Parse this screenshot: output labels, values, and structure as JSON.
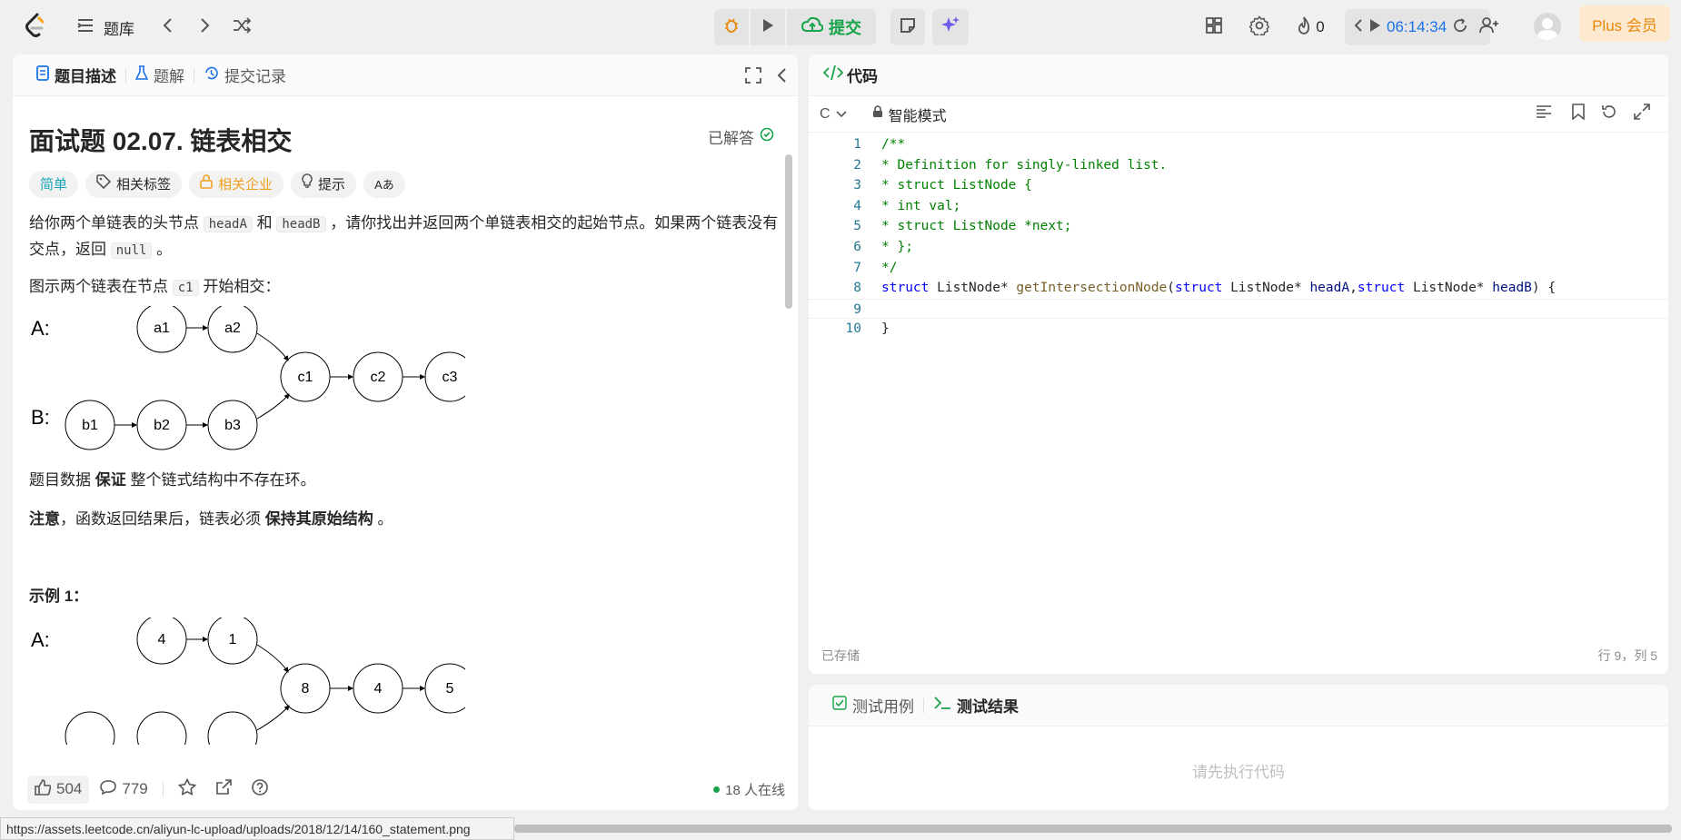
{
  "topbar": {
    "problem_bank": "题库",
    "submit": "提交",
    "streak": "0",
    "timer": "06:14:34",
    "plus": "Plus 会员"
  },
  "left": {
    "tabs": [
      "题目描述",
      "题解",
      "提交记录"
    ],
    "title": "面试题 02.07. 链表相交",
    "solved": "已解答",
    "chips": {
      "difficulty": "简单",
      "tags": "相关标签",
      "companies": "相关企业",
      "hint": "提示",
      "font": "Aあ"
    },
    "desc1_a": "给你两个单链表的头节点 ",
    "desc1_code1": "headA",
    "desc1_b": " 和 ",
    "desc1_code2": "headB",
    "desc1_c": " ，请你找出并返回两个单链表相交的起始节点。如果两个链表没有交点，返回 ",
    "desc1_code3": "null",
    "desc1_d": " 。",
    "desc2_a": "图示两个链表在节点 ",
    "desc2_code": "c1",
    "desc2_b": " 开始相交：",
    "diagram1": {
      "A": "A:",
      "B": "B:",
      "a": [
        "a1",
        "a2"
      ],
      "c": [
        "c1",
        "c2",
        "c3"
      ],
      "b": [
        "b1",
        "b2",
        "b3"
      ]
    },
    "desc3_a": "题目数据 ",
    "desc3_strong": "保证",
    "desc3_b": " 整个链式结构中不存在环。",
    "desc4_strong1": "注意",
    "desc4_a": "，函数返回结果后，链表必须 ",
    "desc4_strong2": "保持其原始结构",
    "desc4_b": " 。",
    "example1": "示例 1：",
    "diagram2": {
      "A": "A:",
      "a": [
        "4",
        "1"
      ],
      "c": [
        "8",
        "4",
        "5"
      ]
    },
    "likes": "504",
    "comments": "779",
    "online": "18 人在线"
  },
  "code": {
    "tab": "代码",
    "language": "C",
    "mode": "智能模式",
    "saved": "已存储",
    "position": "行 9，列 5",
    "lines": [
      "/**",
      " * Definition for singly-linked list.",
      " * struct ListNode {",
      " *     int val;",
      " *     struct ListNode *next;",
      " * };",
      " */",
      "struct ListNode* getIntersectionNode(struct ListNode* headA,struct ListNode* headB) {",
      "    ",
      "}"
    ]
  },
  "test": {
    "tab_cases": "测试用例",
    "tab_result": "测试结果",
    "placeholder": "请先执行代码"
  },
  "statusbar": {
    "url": "https://assets.leetcode.cn/aliyun-lc-upload/uploads/2018/12/14/160_statement.png"
  }
}
